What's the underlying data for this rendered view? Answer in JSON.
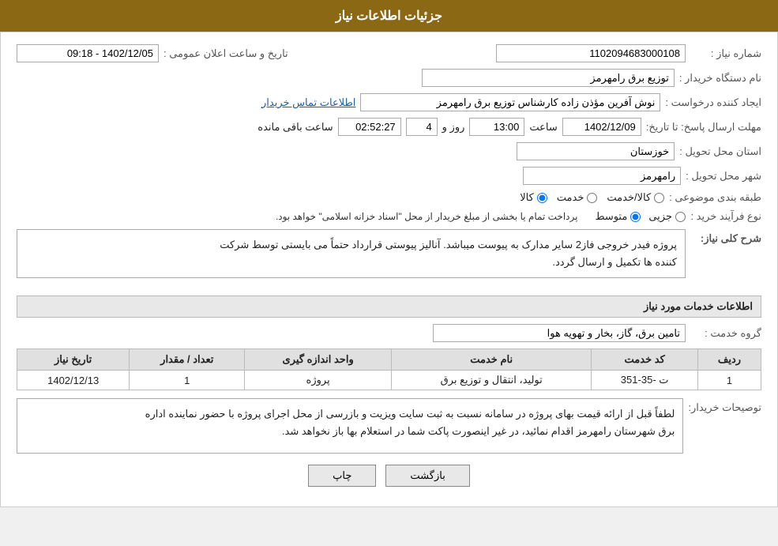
{
  "header": {
    "title": "جزئیات اطلاعات نیاز"
  },
  "fields": {
    "need_number_label": "شماره نیاز :",
    "need_number_value": "1102094683000108",
    "buyer_system_label": "نام دستگاه خریدار :",
    "buyer_system_value": "توزیع برق رامهرمز",
    "creator_label": "ایجاد کننده درخواست :",
    "creator_value": "نوش آفرین مؤذن زاده کارشناس توزیع برق رامهرمز",
    "creator_link": "اطلاعات تماس خریدار",
    "deadline_label": "مهلت ارسال پاسخ: تا تاریخ:",
    "date_value": "1402/12/09",
    "time_label": "ساعت",
    "time_value": "13:00",
    "days_label": "روز و",
    "days_value": "4",
    "remaining_label": "ساعت باقی مانده",
    "remaining_value": "02:52:27",
    "province_label": "استان محل تحویل :",
    "province_value": "خوزستان",
    "city_label": "شهر محل تحویل :",
    "city_value": "رامهرمز",
    "category_label": "طبقه بندی موضوعی :",
    "category_options": [
      "کالا",
      "خدمت",
      "کالا/خدمت"
    ],
    "category_selected": "کالا",
    "process_label": "نوع فرآیند خرید :",
    "process_options": [
      "جزیی",
      "متوسط"
    ],
    "process_note": "پرداخت تمام یا بخشی از مبلغ خریدار از محل \"اسناد خزانه اسلامی\" خواهد بود.",
    "announcement_label": "تاریخ و ساعت اعلان عمومی :",
    "announcement_value": "1402/12/05 - 09:18"
  },
  "description": {
    "section_title": "شرح کلی نیاز:",
    "text_line1": "پروژه فیدر خروجی فاز2 سایر مدارک به پیوست میباشد. آنالیز پیوستی قرارداد حتماً می بایستی توسط شرکت",
    "text_line2": "کننده ها تکمیل و ارسال گردد."
  },
  "services": {
    "section_title": "اطلاعات خدمات مورد نیاز",
    "service_group_label": "گروه خدمت :",
    "service_group_value": "تامین برق، گاز، بخار و تهویه هوا",
    "table": {
      "headers": [
        "ردیف",
        "کد خدمت",
        "نام خدمت",
        "واحد اندازه گیری",
        "تعداد / مقدار",
        "تاریخ نیاز"
      ],
      "rows": [
        {
          "row": "1",
          "code": "ت -35-351",
          "name": "تولید، انتقال و توزیع برق",
          "unit": "پروژه",
          "quantity": "1",
          "date": "1402/12/13"
        }
      ]
    }
  },
  "buyer_notes": {
    "label": "توصیحات خریدار:",
    "line1": "لطفاً قبل از ارائه قیمت بهای پروژه در سامانه نسبت به ثبت سایت ویزیت و بازرسی از محل اجرای پروژه با حضور نماینده اداره",
    "line2": "برق شهرستان رامهرمز اقدام نمائید، در غیر اینصورت پاکت شما در استعلام بها باز نخواهد شد."
  },
  "buttons": {
    "back": "بازگشت",
    "print": "چاپ"
  }
}
